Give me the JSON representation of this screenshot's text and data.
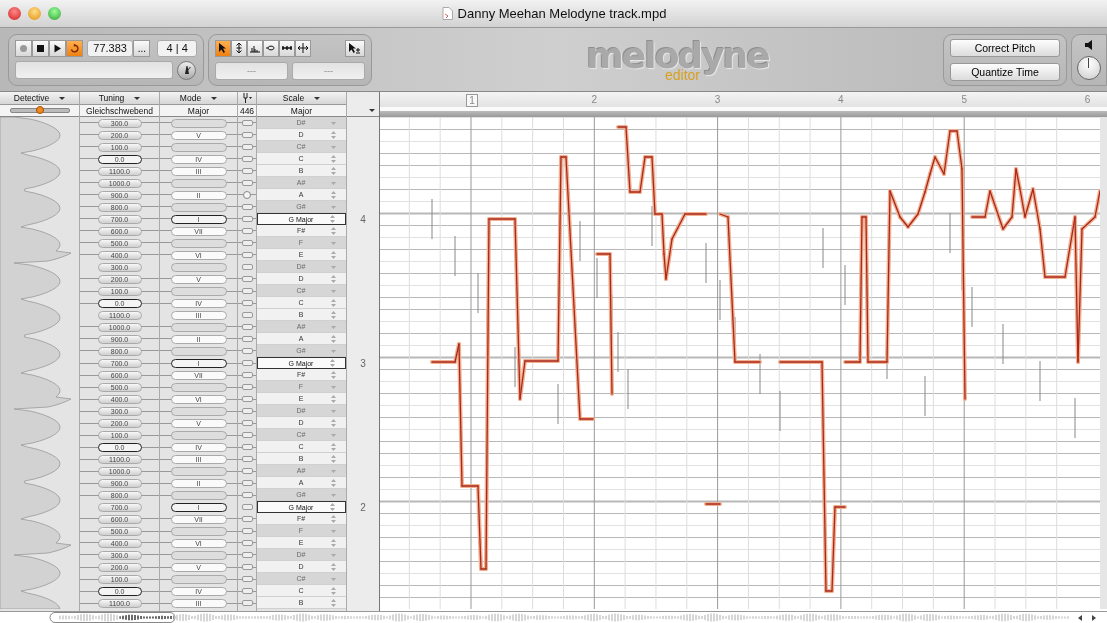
{
  "window": {
    "title": "Danny Meehan Melodyne track.mpd"
  },
  "transport": [
    {
      "kind": "record",
      "on": false
    },
    {
      "kind": "stop",
      "on": false
    },
    {
      "kind": "play",
      "on": false
    },
    {
      "kind": "loop",
      "on": true
    }
  ],
  "tempo": "77.383",
  "tempo_menu": "...",
  "time_signature": "4 | 4",
  "tools": [
    {
      "kind": "main",
      "selected": true
    },
    {
      "kind": "pitch",
      "selected": false
    },
    {
      "kind": "formant",
      "selected": false
    },
    {
      "kind": "amplitude",
      "selected": false
    },
    {
      "kind": "timing",
      "selected": false
    },
    {
      "kind": "separation",
      "selected": false
    }
  ],
  "tool_fields": [
    "---",
    "---"
  ],
  "logo": {
    "name": "melodyne",
    "edition": "editor"
  },
  "actions": [
    "Correct Pitch",
    "Quantize Time"
  ],
  "headers": [
    {
      "kind": "text",
      "label": "Detective"
    },
    {
      "kind": "text",
      "label": "Tuning"
    },
    {
      "kind": "text",
      "label": "Mode"
    },
    {
      "kind": "icon"
    },
    {
      "kind": "text",
      "label": "Scale"
    }
  ],
  "detective": {
    "level": 0.5
  },
  "tuning": "Gleichschwebend",
  "mode": "Major",
  "reference": "446",
  "scale": "Major",
  "rows": [
    {
      "tuning": "300.0",
      "note": "D#",
      "in_scale": false,
      "tonic": false,
      "boundary": false,
      "reference": false
    },
    {
      "tuning": "200.0",
      "mode": "V",
      "note": "D",
      "in_scale": true,
      "tonic": false,
      "boundary": false,
      "reference": false
    },
    {
      "tuning": "100.0",
      "note": "C#",
      "in_scale": false,
      "tonic": false,
      "boundary": false,
      "reference": false
    },
    {
      "tuning": "0.0",
      "mode": "IV",
      "note": "C",
      "in_scale": true,
      "tonic": false,
      "boundary": true,
      "reference": false
    },
    {
      "tuning": "1100.0",
      "mode": "III",
      "note": "B",
      "in_scale": true,
      "tonic": false,
      "boundary": false,
      "reference": false
    },
    {
      "tuning": "1000.0",
      "note": "A#",
      "in_scale": false,
      "tonic": false,
      "boundary": false,
      "reference": false
    },
    {
      "tuning": "900.0",
      "mode": "II",
      "note": "A",
      "in_scale": true,
      "tonic": false,
      "boundary": false,
      "reference": true
    },
    {
      "tuning": "800.0",
      "note": "G#",
      "in_scale": false,
      "tonic": false,
      "boundary": false,
      "reference": false
    },
    {
      "tuning": "700.0",
      "mode": "I",
      "note": "G Major",
      "in_scale": true,
      "tonic": true,
      "boundary": false,
      "reference": false,
      "octave": "4"
    },
    {
      "tuning": "600.0",
      "mode": "VII",
      "note": "F#",
      "in_scale": true,
      "tonic": false,
      "boundary": false,
      "reference": false
    },
    {
      "tuning": "500.0",
      "note": "F",
      "in_scale": false,
      "tonic": false,
      "boundary": false,
      "reference": false
    },
    {
      "tuning": "400.0",
      "mode": "VI",
      "note": "E",
      "in_scale": true,
      "tonic": false,
      "boundary": false,
      "reference": false
    },
    {
      "tuning": "300.0",
      "note": "D#",
      "in_scale": false,
      "tonic": false,
      "boundary": false,
      "reference": false
    },
    {
      "tuning": "200.0",
      "mode": "V",
      "note": "D",
      "in_scale": true,
      "tonic": false,
      "boundary": false,
      "reference": false
    },
    {
      "tuning": "100.0",
      "note": "C#",
      "in_scale": false,
      "tonic": false,
      "boundary": false,
      "reference": false
    },
    {
      "tuning": "0.0",
      "mode": "IV",
      "note": "C",
      "in_scale": true,
      "tonic": false,
      "boundary": true,
      "reference": false
    },
    {
      "tuning": "1100.0",
      "mode": "III",
      "note": "B",
      "in_scale": true,
      "tonic": false,
      "boundary": false,
      "reference": false
    },
    {
      "tuning": "1000.0",
      "note": "A#",
      "in_scale": false,
      "tonic": false,
      "boundary": false,
      "reference": false
    },
    {
      "tuning": "900.0",
      "mode": "II",
      "note": "A",
      "in_scale": true,
      "tonic": false,
      "boundary": false,
      "reference": false
    },
    {
      "tuning": "800.0",
      "note": "G#",
      "in_scale": false,
      "tonic": false,
      "boundary": false,
      "reference": false
    },
    {
      "tuning": "700.0",
      "mode": "I",
      "note": "G Major",
      "in_scale": true,
      "tonic": true,
      "boundary": false,
      "reference": false,
      "octave": "3"
    },
    {
      "tuning": "600.0",
      "mode": "VII",
      "note": "F#",
      "in_scale": true,
      "tonic": false,
      "boundary": false,
      "reference": false
    },
    {
      "tuning": "500.0",
      "note": "F",
      "in_scale": false,
      "tonic": false,
      "boundary": false,
      "reference": false
    },
    {
      "tuning": "400.0",
      "mode": "VI",
      "note": "E",
      "in_scale": true,
      "tonic": false,
      "boundary": false,
      "reference": false
    },
    {
      "tuning": "300.0",
      "note": "D#",
      "in_scale": false,
      "tonic": false,
      "boundary": false,
      "reference": false
    },
    {
      "tuning": "200.0",
      "mode": "V",
      "note": "D",
      "in_scale": true,
      "tonic": false,
      "boundary": false,
      "reference": false
    },
    {
      "tuning": "100.0",
      "note": "C#",
      "in_scale": false,
      "tonic": false,
      "boundary": false,
      "reference": false
    },
    {
      "tuning": "0.0",
      "mode": "IV",
      "note": "C",
      "in_scale": true,
      "tonic": false,
      "boundary": true,
      "reference": false
    },
    {
      "tuning": "1100.0",
      "mode": "III",
      "note": "B",
      "in_scale": true,
      "tonic": false,
      "boundary": false,
      "reference": false
    },
    {
      "tuning": "1000.0",
      "note": "A#",
      "in_scale": false,
      "tonic": false,
      "boundary": false,
      "reference": false
    },
    {
      "tuning": "900.0",
      "mode": "II",
      "note": "A",
      "in_scale": true,
      "tonic": false,
      "boundary": false,
      "reference": false
    },
    {
      "tuning": "800.0",
      "note": "G#",
      "in_scale": false,
      "tonic": false,
      "boundary": false,
      "reference": false
    },
    {
      "tuning": "700.0",
      "mode": "I",
      "note": "G Major",
      "in_scale": true,
      "tonic": true,
      "boundary": false,
      "reference": false,
      "octave": "2"
    },
    {
      "tuning": "600.0",
      "mode": "VII",
      "note": "F#",
      "in_scale": true,
      "tonic": false,
      "boundary": false,
      "reference": false
    },
    {
      "tuning": "500.0",
      "note": "F",
      "in_scale": false,
      "tonic": false,
      "boundary": false,
      "reference": false
    },
    {
      "tuning": "400.0",
      "mode": "VI",
      "note": "E",
      "in_scale": true,
      "tonic": false,
      "boundary": false,
      "reference": false
    },
    {
      "tuning": "300.0",
      "note": "D#",
      "in_scale": false,
      "tonic": false,
      "boundary": false,
      "reference": false
    },
    {
      "tuning": "200.0",
      "mode": "V",
      "note": "D",
      "in_scale": true,
      "tonic": false,
      "boundary": false,
      "reference": false
    },
    {
      "tuning": "100.0",
      "note": "C#",
      "in_scale": false,
      "tonic": false,
      "boundary": false,
      "reference": false
    },
    {
      "tuning": "0.0",
      "mode": "IV",
      "note": "C",
      "in_scale": true,
      "tonic": false,
      "boundary": true,
      "reference": false
    },
    {
      "tuning": "1100.0",
      "mode": "III",
      "note": "B",
      "in_scale": true,
      "tonic": false,
      "boundary": false,
      "reference": false
    }
  ],
  "ruler": [
    {
      "label": "1",
      "marked": true
    },
    {
      "label": "2",
      "marked": false
    },
    {
      "label": "3",
      "marked": false
    },
    {
      "label": "4",
      "marked": false
    },
    {
      "label": "5",
      "marked": false
    },
    {
      "label": "6",
      "marked": false
    }
  ]
}
